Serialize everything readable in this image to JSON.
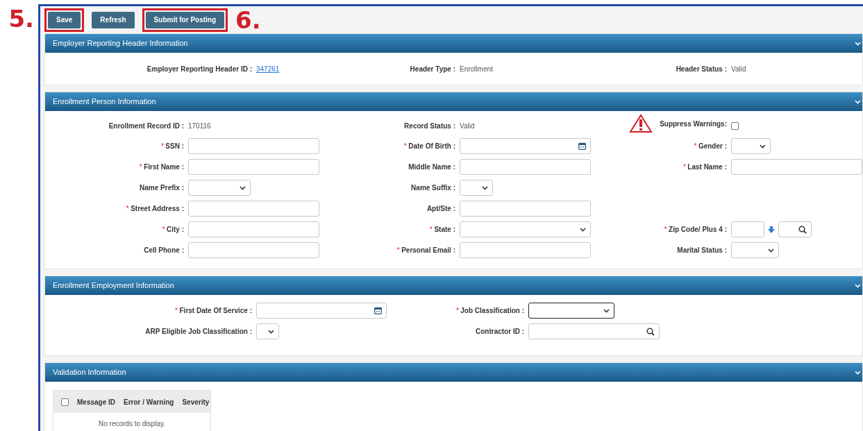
{
  "annotations": [
    {
      "label": "5."
    },
    {
      "label": "6."
    }
  ],
  "toolbar": [
    {
      "label": "Save",
      "highlighted": true
    },
    {
      "label": "Refresh",
      "highlighted": false
    },
    {
      "label": "Submit for Posting",
      "highlighted": true
    }
  ],
  "sections": [
    {
      "kind": "summary",
      "title": "Employer Reporting Header Information",
      "expanded": true,
      "items": [
        {
          "label": "Employer Reporting Header ID :",
          "kind": "link",
          "value": "347261"
        },
        {
          "label": "Header Type :",
          "kind": "value",
          "value": "Enrollment"
        },
        {
          "label": "Header Status :",
          "kind": "value",
          "value": "Valid"
        }
      ]
    },
    {
      "kind": "form3",
      "title": "Enrollment Person Information",
      "expanded": true,
      "rows": [
        [
          {
            "label": "Enrollment Record ID :",
            "kind": "value",
            "value": "170116"
          },
          {
            "label": "Record Status :",
            "kind": "value",
            "value": "Valid"
          },
          {
            "label": "Suppress Warnings:",
            "kind": "checkbox",
            "checked": false,
            "warning": true
          }
        ],
        [
          {
            "label": "SSN :",
            "required_mark": "*",
            "kind": "text"
          },
          {
            "label": "Date Of Birth :",
            "required_mark": "*",
            "kind": "date"
          },
          {
            "label": "Gender :",
            "required_mark": "*",
            "kind": "select-small"
          }
        ],
        [
          {
            "label": "First Name :",
            "required_mark": "*",
            "kind": "text"
          },
          {
            "label": "Middle Name :",
            "kind": "text"
          },
          {
            "label": "Last Name :",
            "required_mark": "*",
            "kind": "text"
          }
        ],
        [
          {
            "label": "Name Prefix :",
            "kind": "select-medium"
          },
          {
            "label": "Name Suffix :",
            "kind": "select-tiny"
          },
          null
        ],
        [
          {
            "label": "Street Address :",
            "required_mark": "*",
            "kind": "text"
          },
          {
            "label": "Apt/Ste :",
            "kind": "text"
          },
          null
        ],
        [
          {
            "label": "City :",
            "required_mark": "*",
            "kind": "text"
          },
          {
            "label": "State :",
            "required_mark": "*",
            "kind": "select-full"
          },
          {
            "label": "Zip Code/ Plus 4 :",
            "required_mark": "*",
            "kind": "zip"
          }
        ],
        [
          {
            "label": "Cell Phone :",
            "kind": "text"
          },
          {
            "label": "Personal Email :",
            "required_mark": "*",
            "kind": "text"
          },
          {
            "label": "Marital Status :",
            "kind": "select-compact"
          }
        ]
      ]
    },
    {
      "kind": "form2",
      "title": "Enrollment Employment Information",
      "expanded": true,
      "rows": [
        [
          {
            "label": "First Date Of Service :",
            "required_mark": "*",
            "kind": "date"
          },
          {
            "label": "Job Classification :",
            "required_mark": "*",
            "kind": "select-large",
            "focused": true
          }
        ],
        [
          {
            "label": "ARP Eligible Job Classification :",
            "kind": "select-mini"
          },
          {
            "label": "Contractor ID :",
            "kind": "lookup"
          }
        ]
      ]
    },
    {
      "kind": "grid",
      "title": "Validation Information",
      "expanded": true,
      "all_checked": false,
      "columns": [
        "Message ID",
        "Error / Warning",
        "Severity"
      ],
      "empty_text": "No records to display."
    }
  ]
}
